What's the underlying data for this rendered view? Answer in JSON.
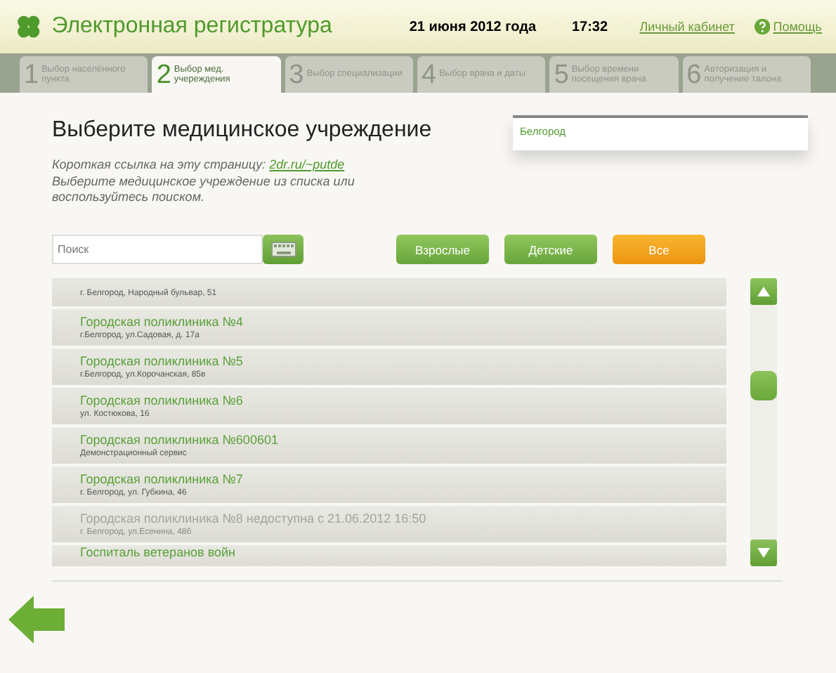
{
  "header": {
    "title": "Электронная регистратура",
    "date": "21 июня 2012 года",
    "time": "17:32",
    "account_link": "Личный кабинет",
    "help_link": "Помощь"
  },
  "steps": [
    {
      "number": "1",
      "label": "Выбор населённого пункта",
      "selected": false
    },
    {
      "number": "2",
      "label": "Выбор мед. учереждения",
      "selected": true
    },
    {
      "number": "3",
      "label": "Выбор специализации",
      "selected": false
    },
    {
      "number": "4",
      "label": "Выбор врача и даты",
      "selected": false
    },
    {
      "number": "5",
      "label": "Выбор времени посещения врача",
      "selected": false
    },
    {
      "number": "6",
      "label": "Авторизация и получение талона",
      "selected": false
    }
  ],
  "heading": "Выберите медицинское учреждение",
  "city": "Белгород",
  "short_link_label": "Короткая ссылка на эту страницу:",
  "short_link": "2dr.ru/~putde",
  "hint": "Выберите медицинское учреждение из списка или воспользуйтесь поиском.",
  "search": {
    "placeholder": "Поиск"
  },
  "filters": [
    {
      "label": "Взрослые",
      "selected": false
    },
    {
      "label": "Детские",
      "selected": false
    },
    {
      "label": "Все",
      "selected": true
    }
  ],
  "clinics": [
    {
      "address": "г. Белгород, Народный бульвар, 51",
      "disabled": false
    },
    {
      "name": "Городская поликлиника №4",
      "address": "г.Белгород, ул.Садовая, д. 17а",
      "disabled": false
    },
    {
      "name": "Городская поликлиника №5",
      "address": "г.Белгород, ул.Корочанская, 85в",
      "disabled": false
    },
    {
      "name": "Городская поликлиника №6",
      "address": "ул. Костюкова, 16",
      "disabled": false
    },
    {
      "name": "Городская поликлиника №600601",
      "address": "Демонстрационный сервис",
      "disabled": false
    },
    {
      "name": "Городская поликлиника №7",
      "address": "г. Белгород, ул. Губкина, 46",
      "disabled": false
    },
    {
      "name": "Городская поликлиника №8 недоступна с 21.06.2012 16:50",
      "address": "г. Белгород, ул.Есенина, 48б",
      "disabled": true
    },
    {
      "name": "Госпиталь ветеранов войн",
      "disabled": false
    }
  ]
}
